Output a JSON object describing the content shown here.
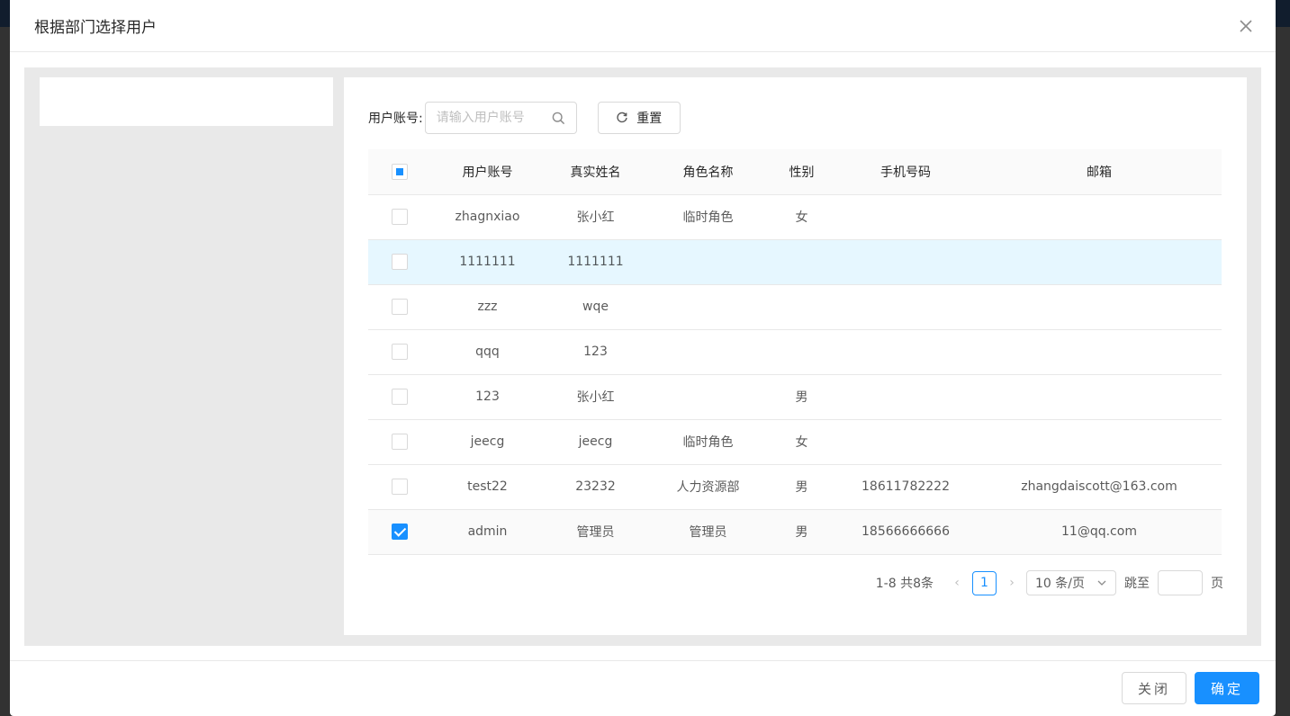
{
  "modal": {
    "title": "根据部门选择用户"
  },
  "search": {
    "label": "用户账号:",
    "placeholder": "请输入用户账号",
    "reset_label": "重置"
  },
  "table": {
    "columns": [
      "用户账号",
      "真实姓名",
      "角色名称",
      "性别",
      "手机号码",
      "邮箱"
    ],
    "rows": [
      {
        "account": "zhagnxiao",
        "name": "张小红",
        "role": "临时角色",
        "gender": "女",
        "phone": "",
        "email": "",
        "checked": false
      },
      {
        "account": "1111111",
        "name": "1111111",
        "role": "",
        "gender": "",
        "phone": "",
        "email": "",
        "checked": false
      },
      {
        "account": "zzz",
        "name": "wqe",
        "role": "",
        "gender": "",
        "phone": "",
        "email": "",
        "checked": false
      },
      {
        "account": "qqq",
        "name": "123",
        "role": "",
        "gender": "",
        "phone": "",
        "email": "",
        "checked": false
      },
      {
        "account": "123",
        "name": "张小红",
        "role": "",
        "gender": "男",
        "phone": "",
        "email": "",
        "checked": false
      },
      {
        "account": "jeecg",
        "name": "jeecg",
        "role": "临时角色",
        "gender": "女",
        "phone": "",
        "email": "",
        "checked": false
      },
      {
        "account": "test22",
        "name": "23232",
        "role": "人力资源部",
        "gender": "男",
        "phone": "18611782222",
        "email": "zhangdaiscott@163.com",
        "checked": false
      },
      {
        "account": "admin",
        "name": "管理员",
        "role": "管理员",
        "gender": "男",
        "phone": "18566666666",
        "email": "11@qq.com",
        "checked": true
      }
    ]
  },
  "pagination": {
    "total": "1-8 共8条",
    "current_page": "1",
    "page_size": "10 条/页",
    "jump_label": "跳至",
    "page_suffix": "页"
  },
  "footer": {
    "close_label": "关闭",
    "ok_label": "确定"
  },
  "colors": {
    "primary": "#1890ff",
    "hover_row": "#e6f7ff"
  }
}
